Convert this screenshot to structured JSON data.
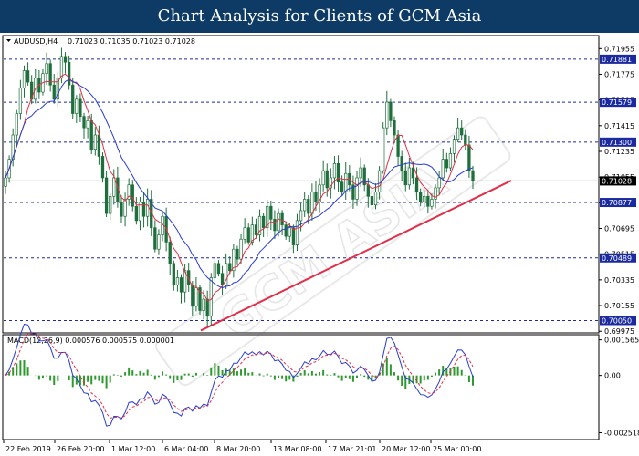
{
  "header": {
    "title": "Chart Analysis for Clients of GCM Asia"
  },
  "chart_data": [
    {
      "type": "candlestick",
      "symbol": "AUDUSD,H4",
      "ohlc_label": "0.71023 0.71035 0.71023 0.71028",
      "ylim": [
        0.6997,
        0.7204
      ],
      "y_ticks": [
        0.71955,
        0.71775,
        0.71595,
        0.71415,
        0.71235,
        0.71055,
        0.70875,
        0.70695,
        0.70515,
        0.70335,
        0.70155,
        0.69975
      ],
      "y_tick_labels": [
        "0.71955",
        "0.71775",
        "0.71595",
        "0.71415",
        "0.71235",
        "0.71055",
        "0.70875",
        "0.70695",
        "0.70515",
        "0.70335",
        "0.70155",
        "0.69975"
      ],
      "x_labels": [
        "22 Feb 2019",
        "26 Feb 20:00",
        "1 Mar 12:00",
        "6 Mar 04:00",
        "8 Mar 20:00",
        "13 Mar 08:00",
        "17 Mar 21:01",
        "20 Mar 12:00",
        "25 Mar 00:00"
      ],
      "levels": [
        {
          "value": 0.71881,
          "label": "0.71881"
        },
        {
          "value": 0.71579,
          "label": "0.71579"
        },
        {
          "value": 0.713,
          "label": "0.71300"
        },
        {
          "value": 0.70877,
          "label": "0.70877"
        },
        {
          "value": 0.70489,
          "label": "0.70489"
        },
        {
          "value": 0.7005,
          "label": "0.70050"
        }
      ],
      "current_price": {
        "value": 0.71028,
        "label": "0.71028"
      },
      "close_series": [
        0.7105,
        0.7118,
        0.7135,
        0.715,
        0.7168,
        0.718,
        0.7172,
        0.716,
        0.7175,
        0.7165,
        0.7178,
        0.7185,
        0.717,
        0.716,
        0.7175,
        0.719,
        0.7186,
        0.717,
        0.715,
        0.716,
        0.7148,
        0.714,
        0.7145,
        0.7125,
        0.7135,
        0.712,
        0.7105,
        0.708,
        0.7092,
        0.7105,
        0.7088,
        0.7078,
        0.709,
        0.71,
        0.7085,
        0.7075,
        0.7088,
        0.7078,
        0.709,
        0.707,
        0.7055,
        0.7065,
        0.7078,
        0.706,
        0.7045,
        0.703,
        0.7035,
        0.7025,
        0.704,
        0.703,
        0.7015,
        0.7028,
        0.7012,
        0.702,
        0.7008,
        0.7035,
        0.7045,
        0.7038,
        0.703,
        0.7045,
        0.704,
        0.7055,
        0.7048,
        0.7062,
        0.707,
        0.706,
        0.7072,
        0.7065,
        0.7078,
        0.707,
        0.7085,
        0.7076,
        0.7068,
        0.708,
        0.7072,
        0.7064,
        0.707,
        0.7058,
        0.7075,
        0.7082,
        0.709,
        0.708,
        0.7095,
        0.7088,
        0.71,
        0.711,
        0.7098,
        0.7105,
        0.7115,
        0.7102,
        0.7095,
        0.7108,
        0.71,
        0.709,
        0.7105,
        0.7112,
        0.71,
        0.7092,
        0.7086,
        0.7095,
        0.711,
        0.714,
        0.7158,
        0.7145,
        0.7135,
        0.712,
        0.711,
        0.71,
        0.7112,
        0.7105,
        0.7095,
        0.7088,
        0.7092,
        0.7085,
        0.709,
        0.7098,
        0.7105,
        0.7118,
        0.7112,
        0.7122,
        0.7132,
        0.714,
        0.7135,
        0.7128,
        0.711,
        0.7103
      ]
    },
    {
      "type": "macd",
      "label": "MACD(12,26,9) 0.000576 0.000575 0.000001",
      "ylim": [
        -0.00278,
        0.00175
      ],
      "y_ticks": [
        0.001565,
        0.0,
        -0.002518
      ],
      "y_tick_labels": [
        "0.001565",
        "0.00",
        "-0.002518"
      ]
    }
  ],
  "colors": {
    "background": "#ffffff",
    "header": "#0d3b66",
    "bull": "#ffffff",
    "bear": "#1f6f3c",
    "wick": "#1f6f3c",
    "ma_red": "#e0304a",
    "ma_blue": "#2a3ccf",
    "trendline": "#e0304a",
    "level_line": "#1c2a9c",
    "level_tag": "#1c2aa0",
    "macd_hist": "#2e9a2e",
    "macd_line": "#2a3ccf",
    "signal_line": "#e0304a"
  }
}
